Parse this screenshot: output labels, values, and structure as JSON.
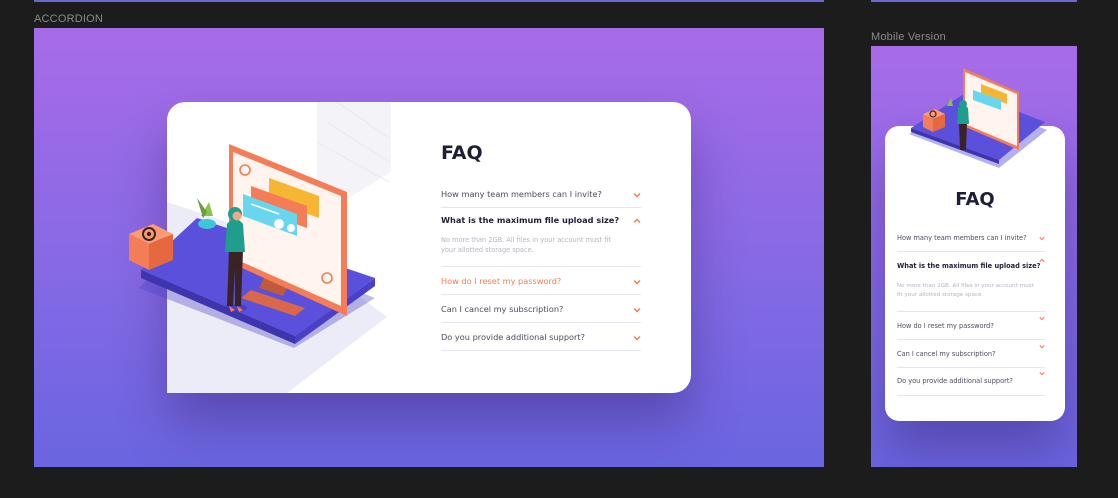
{
  "labels": {
    "desktop": "ACCORDION",
    "mobile": "Mobile Version"
  },
  "colors": {
    "background": "#1c1c1c",
    "gradient_top": "#a86be8",
    "gradient_bottom": "#6a65e0",
    "accent": "#f47c57",
    "title": "#1e1f36",
    "question": "#4b4c5f",
    "answer": "#b4b5c3",
    "divider": "#e6e6ee"
  },
  "faq": {
    "title": "FAQ",
    "items": [
      {
        "question": "How many team members can I invite?",
        "state": "collapsed"
      },
      {
        "question": "What is the maximum file upload size?",
        "state": "expanded",
        "answer": "No more than 2GB. All files in your account must fit your allotted storage space."
      },
      {
        "question": "How do I reset my password?",
        "state": "hover"
      },
      {
        "question": "Can I cancel my subscription?",
        "state": "collapsed"
      },
      {
        "question": "Do you provide additional support?",
        "state": "collapsed"
      }
    ]
  },
  "icons": {
    "chevron_down": "chevron-down-icon",
    "chevron_up": "chevron-up-icon",
    "at_symbol": "at-sign-icon"
  }
}
